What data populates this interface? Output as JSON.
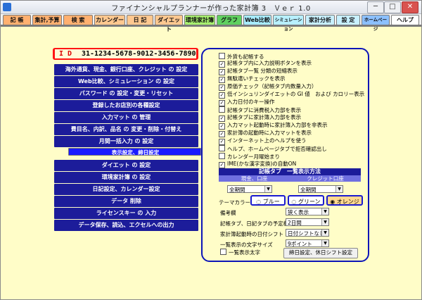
{
  "window": {
    "title": "ファイナンシャルプランナーが作った家計簿 3　Ｖｅｒ 1.0",
    "min_glyph": "─",
    "max_glyph": "□",
    "close_glyph": "✕"
  },
  "menu_tabs": [
    {
      "label": "記 帳",
      "color": "#ffb070"
    },
    {
      "label": "集計,予算",
      "color": "#ffb070"
    },
    {
      "label": "検 索",
      "color": "#ffb070"
    },
    {
      "label": "カレンダー",
      "color": "#ffc890"
    },
    {
      "label": "日 記",
      "color": "#ffc890"
    },
    {
      "label": "ダイエット",
      "color": "#ffc890"
    },
    {
      "label": "環境家計簿",
      "color": "#a8f070"
    },
    {
      "label": "グラフ",
      "color": "#60d060"
    },
    {
      "label": "Web比較",
      "color": "#a8ecff"
    },
    {
      "label": "シミュレーション",
      "color": "#b8f0ff"
    },
    {
      "label": "家計分析",
      "color": "#c8f0ff"
    },
    {
      "label": "設 定",
      "color": "#c8f0ff"
    },
    {
      "label": "ホームページ",
      "color": "#8cc0ff"
    },
    {
      "label": "ヘルプ",
      "color": "#ffffff"
    }
  ],
  "id_box": {
    "label": "I D",
    "value": "31-1234-5678-9012-3456-7890"
  },
  "nav_buttons": [
    "海外通貨、現金、銀行口座、クレジット の 設定",
    "Web比較、シミュレーション の 設定",
    "パスワード の 設定・変更・リセット",
    "登録したお店別の各種設定",
    "入力マット の 管理",
    "費目名、内訳、品名 の 変更・削除・付替え",
    "月間一括入力 の 設定",
    "表示設定、締日設定",
    "ダイエット の 設定",
    "環境家計簿 の 設定",
    "日記設定、カレンダー設定",
    "データ 削除",
    "ライセンスキー の 入力",
    "データ保存、読込、エクセルへの出力"
  ],
  "options": [
    {
      "label": "外貨も記帳する",
      "checked": false
    },
    {
      "label": "記帳タブ内に入力説明ボタンを表示",
      "checked": true
    },
    {
      "label": "記帳タブ一覧 分類の短縮表示",
      "checked": true
    },
    {
      "label": "無駄遣いチェックを表示",
      "checked": true
    },
    {
      "label": "原価チェック（記帳タブ内数量入力）",
      "checked": true
    },
    {
      "label": "低インシュリンダイエットの GI 値　および カロリー表示",
      "checked": true
    },
    {
      "label": "入力日付のキー操作",
      "checked": true
    },
    {
      "label": "記帳タブに消費税入力部を表示",
      "checked": false
    },
    {
      "label": "記帳タブに家計簿入力部を表示",
      "checked": true
    },
    {
      "label": "入力マット起動時に家計簿入力部を非表示",
      "checked": true
    },
    {
      "label": "家計簿の起動時に入力マットを表示",
      "checked": true
    },
    {
      "label": "インターネット上のヘルプを使う",
      "checked": true
    },
    {
      "label": "ヘルプ、ホームページタブで拒否確認出し",
      "checked": false
    },
    {
      "label": "カレンダー月曜始まり",
      "checked": false
    },
    {
      "label": "IME(かな漢字変換)の自動ON",
      "checked": true
    }
  ],
  "ledger_group": {
    "title": "記帳タブ　一覧表示方法",
    "col1": "現金、口座",
    "col2": "クレジット口座",
    "col1_value": "全期間",
    "col2_value": "全期間"
  },
  "theme": {
    "label": "テーマカラー",
    "options": [
      {
        "label": "ブルー",
        "color": "#ffffff"
      },
      {
        "label": "グリーン",
        "color": "#ffffff"
      },
      {
        "label": "オレンジ",
        "color": "#ffd890"
      }
    ]
  },
  "settings_rows": [
    {
      "label": "備考欄",
      "value": "狭く表示"
    },
    {
      "label": "記帳タブ、日記タブの予定欄",
      "value": "2日間"
    },
    {
      "label": "家計簿起動時の日付シフト",
      "value": "日付シフトなし"
    },
    {
      "label": "一覧表示の文字サイズ",
      "value": "9ポイント"
    }
  ],
  "bold_list": {
    "label": "一覧表示太字",
    "checked": false
  },
  "closing_button": "締日設定、休日シフト設定"
}
